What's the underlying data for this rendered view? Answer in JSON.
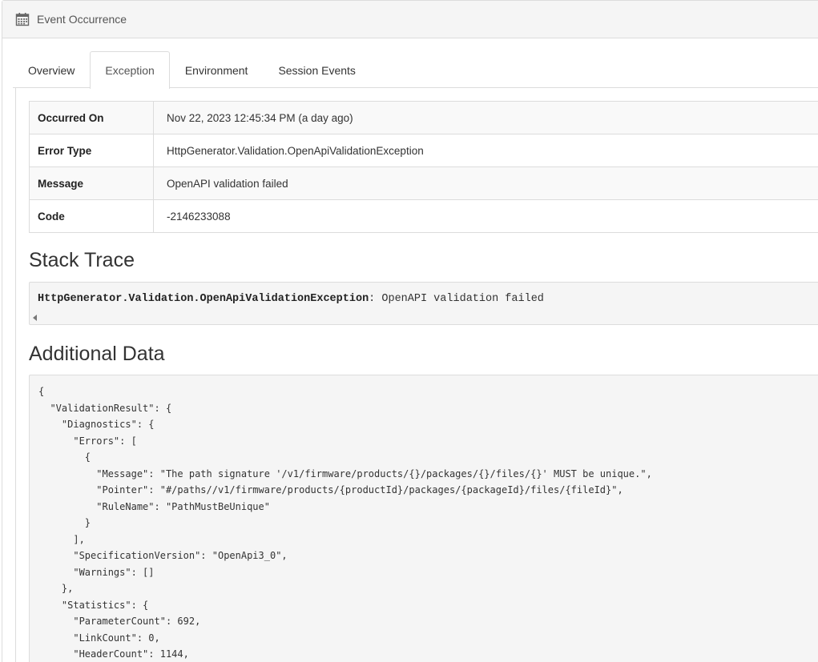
{
  "header": {
    "title": "Event Occurrence",
    "icon": "calendar-icon"
  },
  "tabs": [
    {
      "label": "Overview",
      "active": false
    },
    {
      "label": "Exception",
      "active": true
    },
    {
      "label": "Environment",
      "active": false
    },
    {
      "label": "Session Events",
      "active": false
    }
  ],
  "details": {
    "rows": [
      {
        "key": "Occurred On",
        "value": "Nov 22, 2023 12:45:34 PM (a day ago)"
      },
      {
        "key": "Error Type",
        "value": "HttpGenerator.Validation.OpenApiValidationException"
      },
      {
        "key": "Message",
        "value": "OpenAPI validation failed"
      },
      {
        "key": "Code",
        "value": "-2146233088"
      }
    ]
  },
  "stack_trace": {
    "heading": "Stack Trace",
    "exception_type": "HttpGenerator.Validation.OpenApiValidationException",
    "message": ": OpenAPI validation failed"
  },
  "additional_data": {
    "heading": "Additional Data",
    "json_lines": [
      "{",
      "  \"ValidationResult\": {",
      "    \"Diagnostics\": {",
      "      \"Errors\": [",
      "        {",
      "          \"Message\": \"The path signature '/v1/firmware/products/{}/packages/{}/files/{}' MUST be unique.\",",
      "          \"Pointer\": \"#/paths//v1/firmware/products/{productId}/packages/{packageId}/files/{fileId}\",",
      "          \"RuleName\": \"PathMustBeUnique\"",
      "        }",
      "      ],",
      "      \"SpecificationVersion\": \"OpenApi3_0\",",
      "      \"Warnings\": []",
      "    },",
      "    \"Statistics\": {",
      "      \"ParameterCount\": 692,",
      "      \"LinkCount\": 0,",
      "      \"HeaderCount\": 1144,"
    ]
  }
}
